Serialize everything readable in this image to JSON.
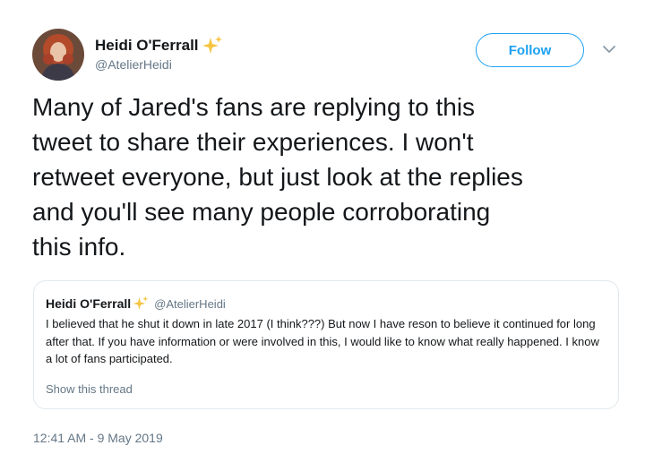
{
  "tweet": {
    "author": {
      "name": "Heidi O'Ferrall",
      "handle": "@AtelierHeidi",
      "emoji_icon": "sparkles-icon"
    },
    "follow_label": "Follow",
    "menu_icon": "chevron-down-icon",
    "text": "Many of Jared's fans are replying to this\ntweet to share their experiences. I won't\nretweet everyone, but just look at the replies\nand you'll see many people corroborating\nthis info.",
    "quoted": {
      "name": "Heidi O'Ferrall",
      "handle": "@AtelierHeidi",
      "text": "I believed that he shut it down in late 2017 (I think???) But now I have reson to believe it continued for long after that. If you have information or were involved in this, I would like to know what really happened. I know a lot of fans participated.",
      "show_thread": "Show this thread"
    },
    "timestamp": "12:41 AM - 9 May 2019"
  },
  "colors": {
    "accent": "#1da1f2",
    "secondary_text": "#657786",
    "border": "#e1e8ed",
    "sparkle": "#f5c542"
  }
}
